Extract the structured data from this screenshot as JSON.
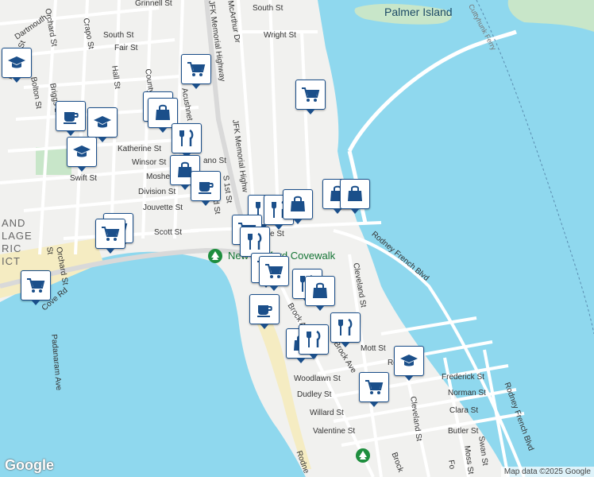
{
  "colors": {
    "water": "#8fd8ee",
    "land": "#f1f1ef",
    "park": "#c8e6c9",
    "beach": "#f5ecc2",
    "road": "#ffffff",
    "highway": "#d9d9d9",
    "pin_border": "#1b4f8a"
  },
  "labels": {
    "palmer_island": "Palmer Island",
    "ferry": "Cuttyhunk Ferry",
    "park": "New Bedford Covewalk",
    "district": [
      "AND",
      "LAGE",
      "RIC",
      "ICT"
    ],
    "streets": {
      "dartmouth": "Dartmouth",
      "orchard": "Orchard St",
      "crapo": "Crapo St",
      "grinnell": "Grinnell St",
      "south": "South St",
      "fair": "Fair St",
      "wright": "Wright St",
      "mcarthur": "McArthur Dr",
      "south2": "South St",
      "jfk1": "JFK Memorial Highway",
      "jfk2": "JFK Memorial Highw",
      "hall": "Hall St",
      "county": "County St",
      "acushnet": "Acushnet",
      "hemlock": "Hemlock St",
      "bolton": "Bolton St",
      "briggs": "Briggs St",
      "katherine": "Katherine St",
      "winsor": "Winsor St",
      "mosher": "Mosher St",
      "division": "Division St",
      "jouvette": "Jouvette St",
      "swift": "Swift St",
      "scott": "Scott St",
      "first": "S 1st St",
      "second": "2nd St",
      "third": "3rd St",
      "cove": "Cove Rd",
      "orchard2": "Orchard St",
      "padanaram": "Padanaram Ave",
      "rodney_french": "Rodney French Blvd",
      "cleveland": "Cleveland St",
      "brock1": "Brock Ave",
      "brock2": "Brock Ave",
      "mott": "Mott St",
      "rodney": "Rodney",
      "frederick": "Frederick St",
      "norman": "Norman St",
      "clara": "Clara St",
      "woodlawn": "Woodlawn St",
      "dudley": "Dudley St",
      "willard": "Willard St",
      "valentine": "Valentine St",
      "cleveland2": "Cleveland St",
      "butler": "Butler St",
      "swan": "Swan St",
      "moss": "Moss St",
      "rodney_french2": "Rodney French Blvd",
      "rodney2": "Rodne",
      "brock3": "Brock",
      "ste": "e St",
      "t": "t",
      "fo": "Fo",
      "ano": "ano St",
      "st_small": "St"
    }
  },
  "pins": [
    {
      "icon": "school"
    },
    {
      "icon": "coffee"
    },
    {
      "icon": "school"
    },
    {
      "icon": "school"
    },
    {
      "icon": "grocery"
    },
    {
      "icon": "shopping"
    },
    {
      "icon": "shopping"
    },
    {
      "icon": "restaurant"
    },
    {
      "icon": "shopping"
    },
    {
      "icon": "coffee"
    },
    {
      "icon": "grocery"
    },
    {
      "icon": "grocery"
    },
    {
      "icon": "grocery"
    },
    {
      "icon": "restaurant"
    },
    {
      "icon": "restaurant"
    },
    {
      "icon": "shopping"
    },
    {
      "icon": "grocery"
    },
    {
      "icon": "restaurant"
    },
    {
      "icon": "grocery"
    },
    {
      "icon": "grocery"
    },
    {
      "icon": "shopping"
    },
    {
      "icon": "shopping"
    },
    {
      "icon": "restaurant"
    },
    {
      "icon": "shopping"
    },
    {
      "icon": "coffee"
    },
    {
      "icon": "restaurant"
    },
    {
      "icon": "shopping"
    },
    {
      "icon": "restaurant"
    },
    {
      "icon": "school"
    },
    {
      "icon": "grocery"
    },
    {
      "icon": "grocery"
    }
  ],
  "footer": {
    "logo": "Google",
    "attribution": "Map data ©2025 Google"
  }
}
